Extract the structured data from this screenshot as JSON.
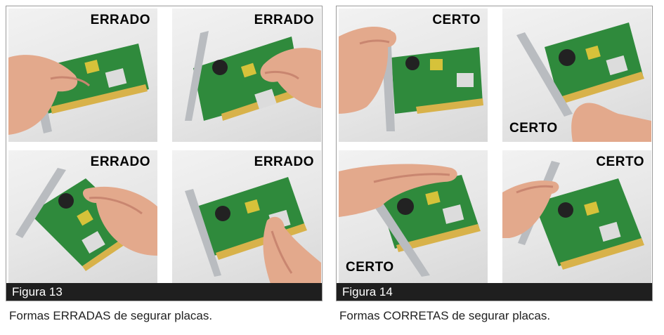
{
  "figures": [
    {
      "label": "Figura 13",
      "caption": "Formas ERRADAS de segurar placas.",
      "photos": [
        {
          "tag": "ERRADO"
        },
        {
          "tag": "ERRADO"
        },
        {
          "tag": "ERRADO"
        },
        {
          "tag": "ERRADO"
        }
      ]
    },
    {
      "label": "Figura 14",
      "caption": "Formas CORRETAS de segurar placas.",
      "photos": [
        {
          "tag": "CERTO"
        },
        {
          "tag": "CERTO"
        },
        {
          "tag": "CERTO"
        },
        {
          "tag": "CERTO"
        }
      ]
    }
  ],
  "colors": {
    "pcb": "#2f8a3c",
    "pcb_dark": "#1f5f2a",
    "gold": "#d8b24a",
    "bracket": "#b9bcc0",
    "skin": "#e3a98c",
    "skin_shadow": "#c98670",
    "label_bar": "#1f1f1f"
  }
}
